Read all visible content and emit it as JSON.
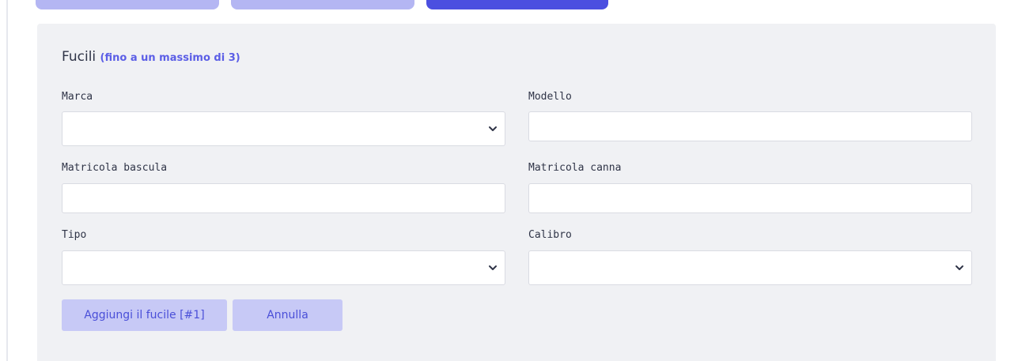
{
  "section": {
    "title": "Fucili",
    "note": "(fino a un massimo di 3)"
  },
  "fields": {
    "marca": {
      "label": "Marca",
      "value": ""
    },
    "modello": {
      "label": "Modello",
      "value": ""
    },
    "matricola_bascula": {
      "label": "Matricola bascula",
      "value": ""
    },
    "matricola_canna": {
      "label": "Matricola canna",
      "value": ""
    },
    "tipo": {
      "label": "Tipo",
      "value": ""
    },
    "calibro": {
      "label": "Calibro",
      "value": ""
    }
  },
  "buttons": {
    "add": "Aggiungi il fucile [#1]",
    "cancel": "Annulla"
  },
  "colors": {
    "accent": "#5b5ee6",
    "step_active": "#4b4fe0",
    "step_inactive": "#b4b6f3",
    "button_bg": "#c7c9f6"
  },
  "icons": {
    "select_arrow": "chevron-down-icon"
  }
}
